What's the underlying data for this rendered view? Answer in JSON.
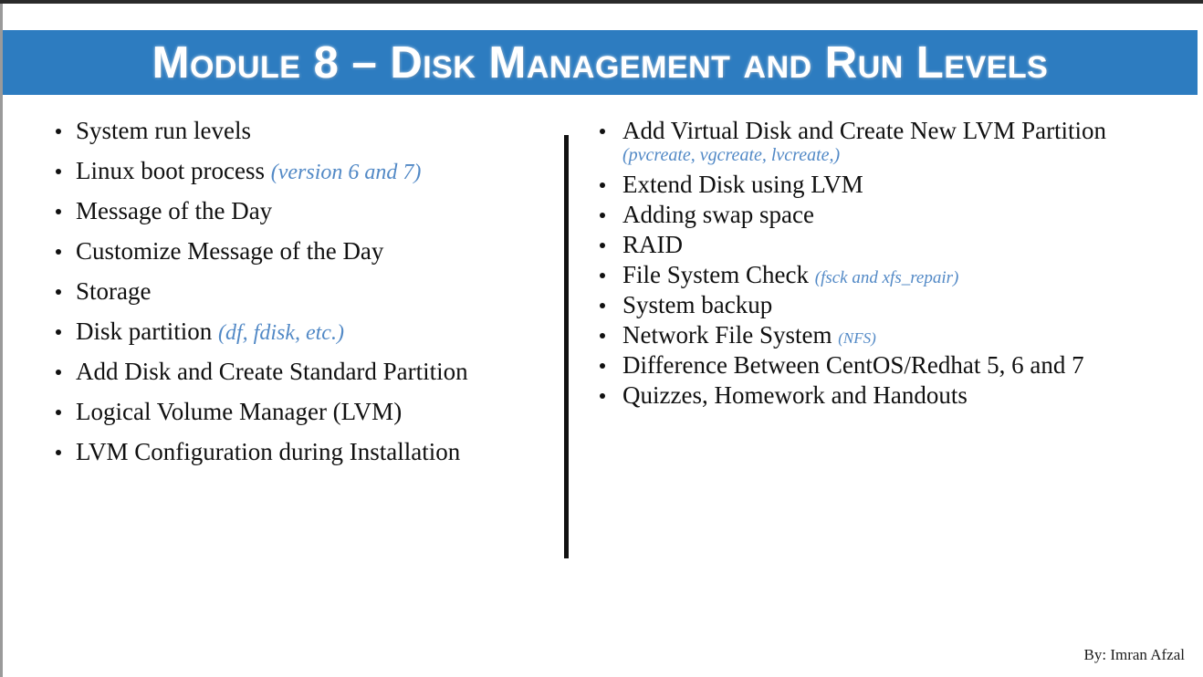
{
  "slide": {
    "title": "Module 8 – Disk Management and Run Levels",
    "banner_color": "#2d7cc0",
    "accent_blue": "#5289c6",
    "accent_purple": "#7e6da6",
    "byline": "By: Imran Afzal"
  },
  "left_column": {
    "items": [
      {
        "text": "System run levels",
        "note": ""
      },
      {
        "text": "Linux boot process ",
        "note": "(version 6 and 7)"
      },
      {
        "text": "Message of the Day",
        "note": ""
      },
      {
        "text": "Customize Message of the Day",
        "note": ""
      },
      {
        "text": "Storage",
        "note": ""
      },
      {
        "text": "Disk partition ",
        "note": "(df, fdisk, etc.)"
      },
      {
        "text": "Add Disk and Create Standard Partition",
        "note": ""
      },
      {
        "text": "Logical Volume Manager (LVM)",
        "note": ""
      },
      {
        "text": "LVM Configuration during Installation",
        "note": ""
      }
    ]
  },
  "right_column": {
    "items": [
      {
        "text": "Add Virtual Disk and Create New LVM Partition",
        "note": "",
        "subnote": "(pvcreate, vgcreate, lvcreate,)"
      },
      {
        "text": "Extend Disk using LVM",
        "note": "",
        "subnote": ""
      },
      {
        "text": "Adding swap space",
        "note": "",
        "subnote": ""
      },
      {
        "text": "RAID",
        "note": "",
        "subnote": ""
      },
      {
        "text": "File System Check ",
        "note": "(fsck and xfs_repair)",
        "subnote": ""
      },
      {
        "text": "System backup",
        "note": "",
        "subnote": ""
      },
      {
        "text": "Network File System ",
        "note": "(NFS)",
        "subnote": ""
      },
      {
        "text": "Difference Between CentOS/Redhat 5, 6 and 7",
        "note": "",
        "subnote": ""
      },
      {
        "text": "Quizzes, Homework and Handouts",
        "note": "",
        "subnote": ""
      }
    ]
  }
}
